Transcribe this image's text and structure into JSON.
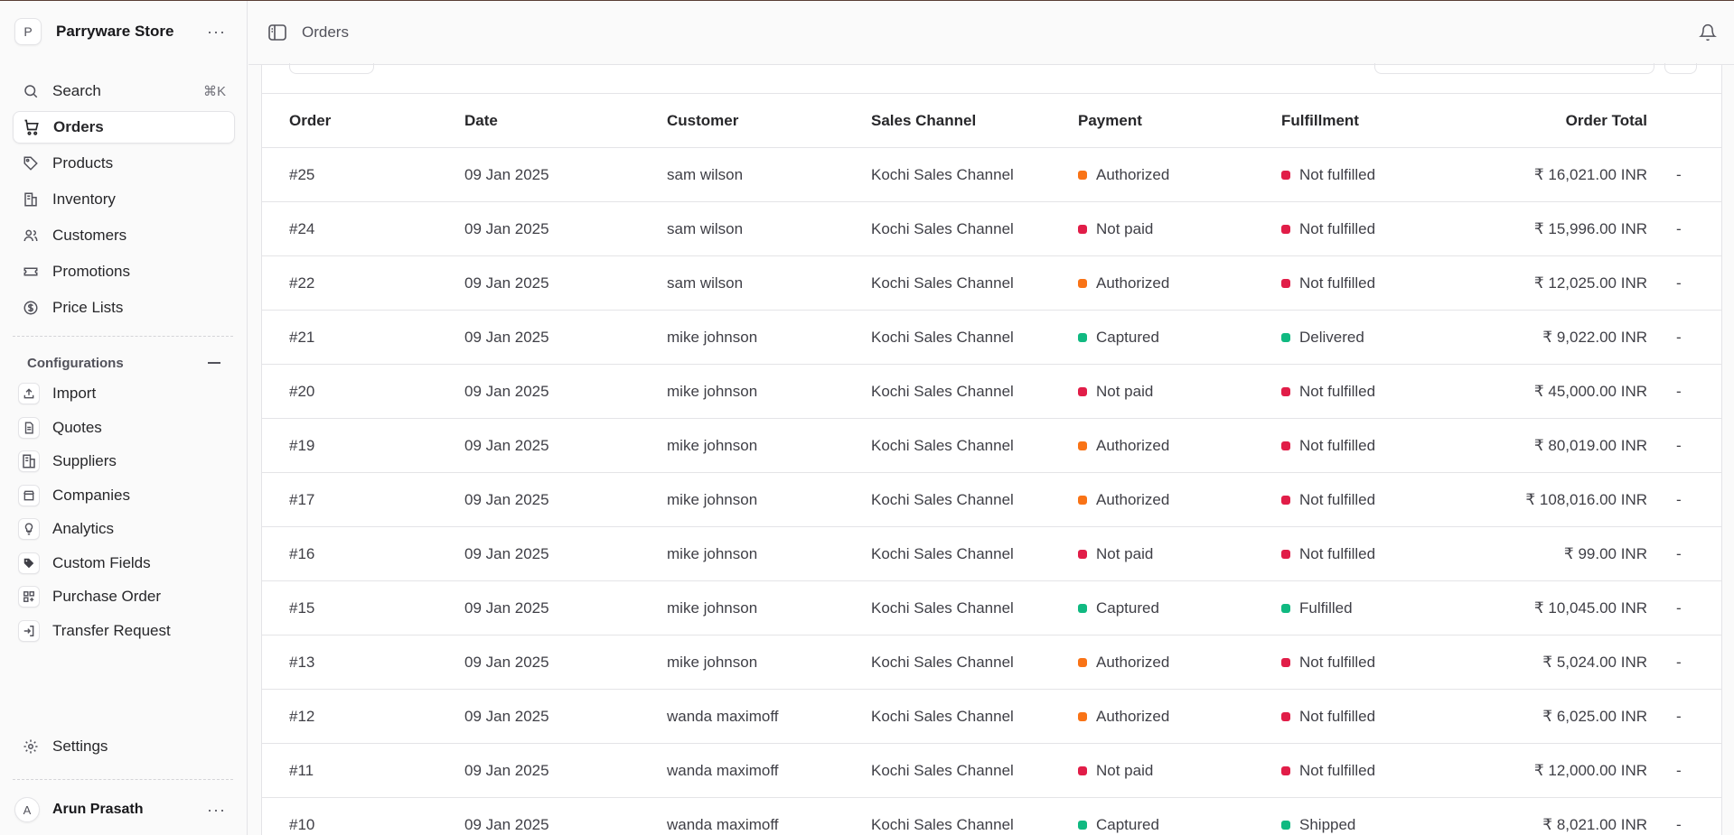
{
  "store": {
    "initial": "P",
    "name": "Parryware Store"
  },
  "nav": [
    {
      "label": "Search",
      "icon": "search-icon",
      "kbd": "⌘K"
    },
    {
      "label": "Orders",
      "icon": "cart-icon",
      "active": true
    },
    {
      "label": "Products",
      "icon": "tag-icon"
    },
    {
      "label": "Inventory",
      "icon": "building-icon"
    },
    {
      "label": "Customers",
      "icon": "users-icon"
    },
    {
      "label": "Promotions",
      "icon": "ticket-icon"
    },
    {
      "label": "Price Lists",
      "icon": "currency-icon"
    }
  ],
  "configurations": {
    "title": "Configurations",
    "items": [
      {
        "label": "Import",
        "icon": "upload-icon"
      },
      {
        "label": "Quotes",
        "icon": "document-icon"
      },
      {
        "label": "Suppliers",
        "icon": "building-icon"
      },
      {
        "label": "Companies",
        "icon": "store-icon"
      },
      {
        "label": "Analytics",
        "icon": "bulb-icon"
      },
      {
        "label": "Custom Fields",
        "icon": "tag-filled-icon"
      },
      {
        "label": "Purchase Order",
        "icon": "grid-plus-icon"
      },
      {
        "label": "Transfer Request",
        "icon": "login-icon"
      }
    ]
  },
  "settings": {
    "label": "Settings",
    "icon": "gear-icon"
  },
  "user": {
    "initial": "A",
    "name": "Arun Prasath"
  },
  "topbar": {
    "breadcrumb": "Orders"
  },
  "table": {
    "columns": [
      "Order",
      "Date",
      "Customer",
      "Sales Channel",
      "Payment",
      "Fulfillment",
      "Order Total"
    ],
    "rows": [
      {
        "order": "#25",
        "date": "09 Jan 2025",
        "customer": "sam wilson",
        "channel": "Kochi Sales Channel",
        "payment": "Authorized",
        "fulfillment": "Not fulfilled",
        "total": "₹ 16,021.00 INR",
        "action": "-"
      },
      {
        "order": "#24",
        "date": "09 Jan 2025",
        "customer": "sam wilson",
        "channel": "Kochi Sales Channel",
        "payment": "Not paid",
        "fulfillment": "Not fulfilled",
        "total": "₹ 15,996.00 INR",
        "action": "-"
      },
      {
        "order": "#22",
        "date": "09 Jan 2025",
        "customer": "sam wilson",
        "channel": "Kochi Sales Channel",
        "payment": "Authorized",
        "fulfillment": "Not fulfilled",
        "total": "₹ 12,025.00 INR",
        "action": "-"
      },
      {
        "order": "#21",
        "date": "09 Jan 2025",
        "customer": "mike johnson",
        "channel": "Kochi Sales Channel",
        "payment": "Captured",
        "fulfillment": "Delivered",
        "total": "₹ 9,022.00 INR",
        "action": "-"
      },
      {
        "order": "#20",
        "date": "09 Jan 2025",
        "customer": "mike johnson",
        "channel": "Kochi Sales Channel",
        "payment": "Not paid",
        "fulfillment": "Not fulfilled",
        "total": "₹ 45,000.00 INR",
        "action": "-"
      },
      {
        "order": "#19",
        "date": "09 Jan 2025",
        "customer": "mike johnson",
        "channel": "Kochi Sales Channel",
        "payment": "Authorized",
        "fulfillment": "Not fulfilled",
        "total": "₹ 80,019.00 INR",
        "action": "-"
      },
      {
        "order": "#17",
        "date": "09 Jan 2025",
        "customer": "mike johnson",
        "channel": "Kochi Sales Channel",
        "payment": "Authorized",
        "fulfillment": "Not fulfilled",
        "total": "₹ 108,016.00 INR",
        "action": "-"
      },
      {
        "order": "#16",
        "date": "09 Jan 2025",
        "customer": "mike johnson",
        "channel": "Kochi Sales Channel",
        "payment": "Not paid",
        "fulfillment": "Not fulfilled",
        "total": "₹ 99.00 INR",
        "action": "-"
      },
      {
        "order": "#15",
        "date": "09 Jan 2025",
        "customer": "mike johnson",
        "channel": "Kochi Sales Channel",
        "payment": "Captured",
        "fulfillment": "Fulfilled",
        "total": "₹ 10,045.00 INR",
        "action": "-"
      },
      {
        "order": "#13",
        "date": "09 Jan 2025",
        "customer": "mike johnson",
        "channel": "Kochi Sales Channel",
        "payment": "Authorized",
        "fulfillment": "Not fulfilled",
        "total": "₹ 5,024.00 INR",
        "action": "-"
      },
      {
        "order": "#12",
        "date": "09 Jan 2025",
        "customer": "wanda maximoff",
        "channel": "Kochi Sales Channel",
        "payment": "Authorized",
        "fulfillment": "Not fulfilled",
        "total": "₹ 6,025.00 INR",
        "action": "-"
      },
      {
        "order": "#11",
        "date": "09 Jan 2025",
        "customer": "wanda maximoff",
        "channel": "Kochi Sales Channel",
        "payment": "Not paid",
        "fulfillment": "Not fulfilled",
        "total": "₹ 12,000.00 INR",
        "action": "-"
      },
      {
        "order": "#10",
        "date": "09 Jan 2025",
        "customer": "wanda maximoff",
        "channel": "Kochi Sales Channel",
        "payment": "Captured",
        "fulfillment": "Shipped",
        "total": "₹ 8,021.00 INR",
        "action": "-"
      }
    ]
  },
  "status_colors": {
    "Authorized": "#f97316",
    "Not paid": "#e11d48",
    "Captured": "#10b981",
    "Not fulfilled": "#e11d48",
    "Delivered": "#10b981",
    "Fulfilled": "#10b981",
    "Shipped": "#10b981"
  }
}
